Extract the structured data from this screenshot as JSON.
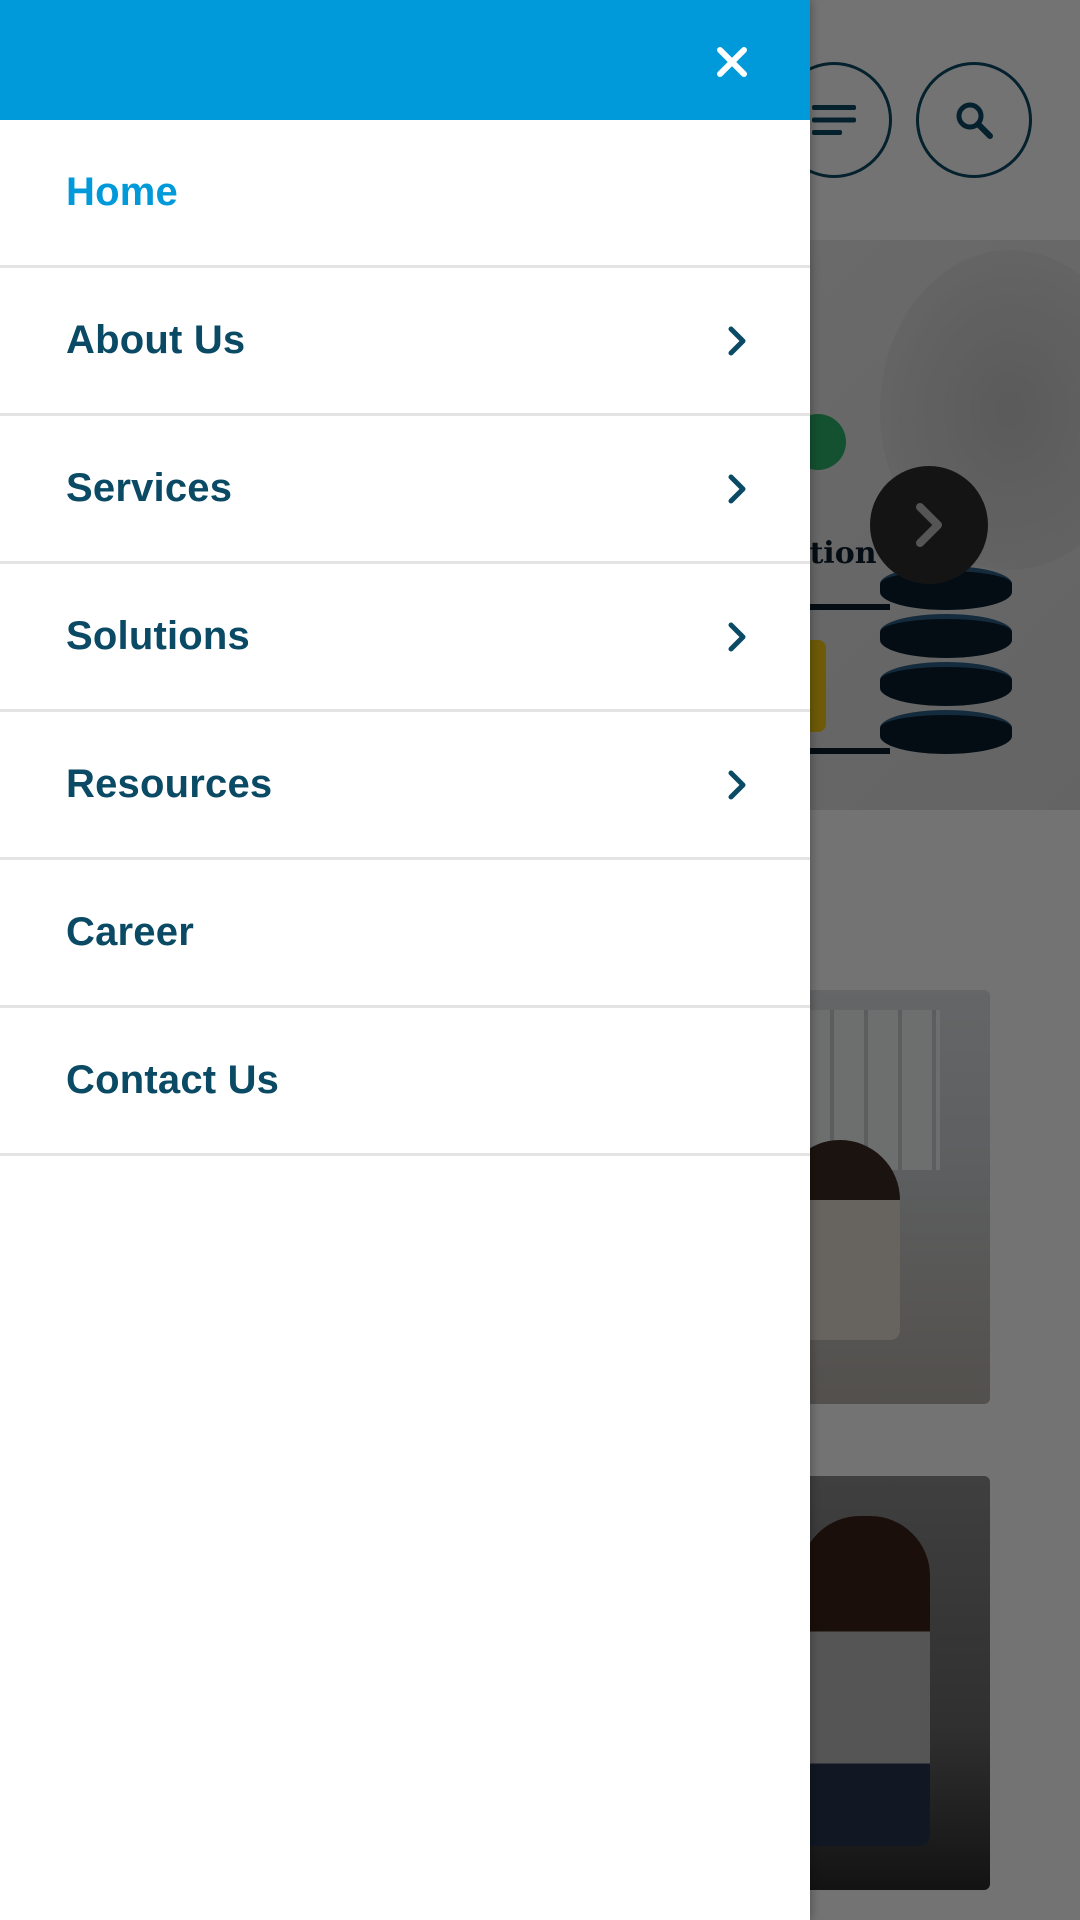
{
  "drawer": {
    "close_icon": "close-icon",
    "header_color": "#0099d9",
    "items": [
      {
        "label": "Home",
        "active": true,
        "has_submenu": false
      },
      {
        "label": "About Us",
        "active": false,
        "has_submenu": true
      },
      {
        "label": "Services",
        "active": false,
        "has_submenu": true
      },
      {
        "label": "Solutions",
        "active": false,
        "has_submenu": true
      },
      {
        "label": "Resources",
        "active": false,
        "has_submenu": true
      },
      {
        "label": "Career",
        "active": false,
        "has_submenu": false
      },
      {
        "label": "Contact Us",
        "active": false,
        "has_submenu": false
      }
    ]
  },
  "background": {
    "hero_caption_fragment": "ation",
    "icons": [
      "hamburger-menu-icon",
      "search-icon",
      "chevron-right-icon",
      "lock-icon",
      "database-icon"
    ]
  },
  "colors": {
    "accent": "#0099d9",
    "nav_text": "#0a4a64",
    "divider": "#e4e4e4"
  }
}
